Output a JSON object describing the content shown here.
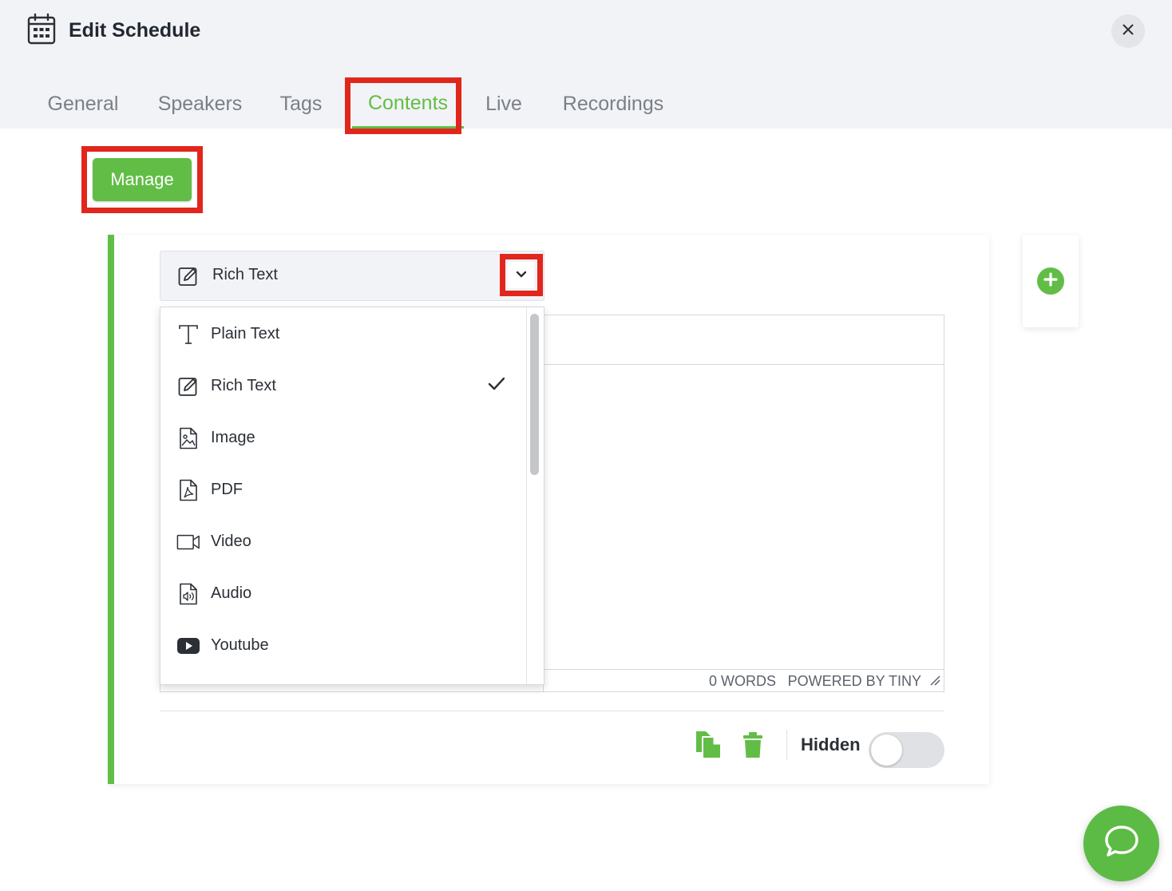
{
  "window": {
    "title": "Edit Schedule",
    "title_icon": "calendar-icon",
    "close_icon": "close-icon"
  },
  "tabs": [
    {
      "label": "General",
      "active": false
    },
    {
      "label": "Speakers",
      "active": false
    },
    {
      "label": "Tags",
      "active": false
    },
    {
      "label": "Contents",
      "active": true
    },
    {
      "label": "Live",
      "active": false
    },
    {
      "label": "Recordings",
      "active": false
    }
  ],
  "manage_button": {
    "label": "Manage"
  },
  "content_block": {
    "type_select": {
      "selected_label": "Rich Text",
      "selected_icon": "edit-pencil-icon",
      "expand_icon": "chevron-down-icon"
    },
    "dropdown_options": [
      {
        "label": "Plain Text",
        "icon": "text-type-icon",
        "selected": false
      },
      {
        "label": "Rich Text",
        "icon": "edit-pencil-icon",
        "selected": true
      },
      {
        "label": "Image",
        "icon": "image-file-icon",
        "selected": false
      },
      {
        "label": "PDF",
        "icon": "pdf-file-icon",
        "selected": false
      },
      {
        "label": "Video",
        "icon": "video-camera-icon",
        "selected": false
      },
      {
        "label": "Audio",
        "icon": "audio-file-icon",
        "selected": false
      },
      {
        "label": "Youtube",
        "icon": "youtube-icon",
        "selected": false
      }
    ],
    "editor_status": {
      "words": "0 WORDS",
      "powered_by": "POWERED BY TINY"
    },
    "footer": {
      "hidden_label": "Hidden",
      "hidden_enabled": false
    }
  },
  "colors": {
    "accent": "#62bd47",
    "highlight": "#e1261c",
    "header_bg": "#f2f3f6"
  }
}
